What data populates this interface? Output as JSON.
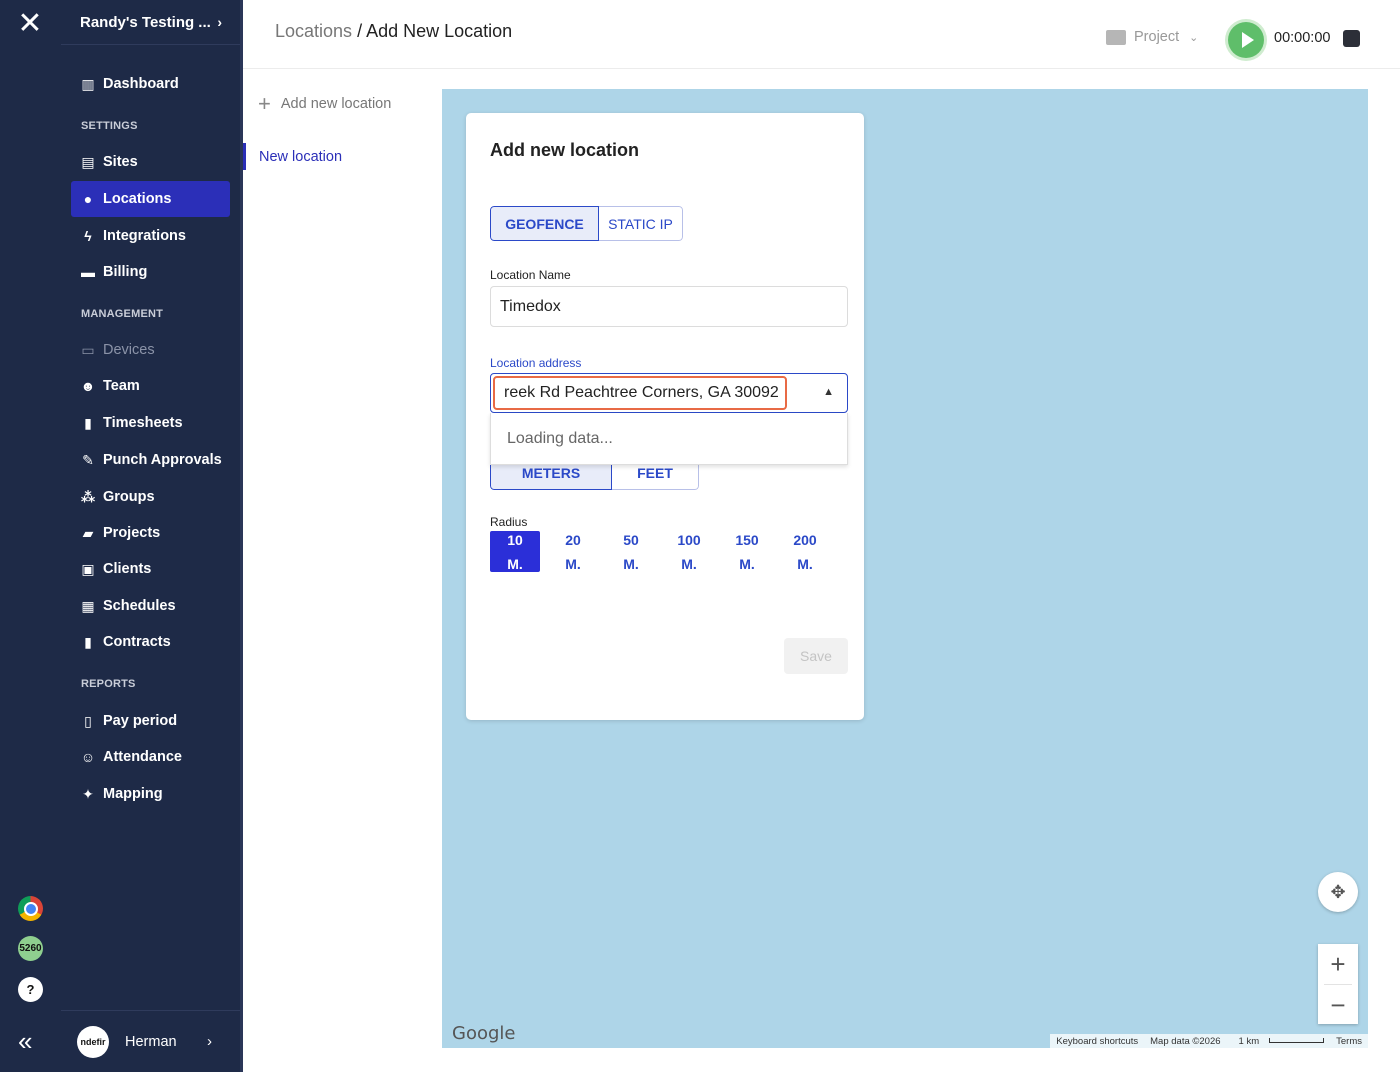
{
  "rail": {
    "logo": "✕",
    "badge_count": "5260",
    "help": "?",
    "collapse": "«"
  },
  "sidebar": {
    "org_name": "Randy's Testing ...",
    "sections": {
      "settings": "SETTINGS",
      "management": "MANAGEMENT",
      "reports": "REPORTS"
    },
    "items": [
      {
        "label": "Dashboard",
        "icon": "chart-icon"
      },
      {
        "label": "Sites",
        "icon": "store-icon"
      },
      {
        "label": "Locations",
        "icon": "pin-icon",
        "active": true
      },
      {
        "label": "Integrations",
        "icon": "bolt-icon"
      },
      {
        "label": "Billing",
        "icon": "card-icon"
      },
      {
        "label": "Devices",
        "icon": "device-icon",
        "disabled": true
      },
      {
        "label": "Team",
        "icon": "team-icon"
      },
      {
        "label": "Timesheets",
        "icon": "sheet-icon"
      },
      {
        "label": "Punch Approvals",
        "icon": "pen-icon"
      },
      {
        "label": "Groups",
        "icon": "groups-icon"
      },
      {
        "label": "Projects",
        "icon": "folder-icon"
      },
      {
        "label": "Clients",
        "icon": "contact-icon"
      },
      {
        "label": "Schedules",
        "icon": "calendar-icon"
      },
      {
        "label": "Contracts",
        "icon": "book-icon"
      },
      {
        "label": "Pay period",
        "icon": "clipboard-icon"
      },
      {
        "label": "Attendance",
        "icon": "user-icon"
      },
      {
        "label": "Mapping",
        "icon": "pushpin-icon"
      }
    ],
    "user": {
      "avatar_text": "ndefir",
      "name": "Herman"
    }
  },
  "header": {
    "breadcrumb_parent": "Locations",
    "breadcrumb_sep": " / ",
    "breadcrumb_current": "Add New Location",
    "project_label": "Project",
    "timer": "00:00:00"
  },
  "subnav": {
    "add_label": "Add new location",
    "active_label": "New location"
  },
  "form": {
    "title": "Add new location",
    "type_options": [
      "GEOFENCE",
      "STATIC IP"
    ],
    "type_selected": "GEOFENCE",
    "name_label": "Location Name",
    "name_value": "Timedox",
    "address_label": "Location address",
    "address_value": "reek Rd Peachtree Corners, GA 30092",
    "dropdown_text": "Loading data...",
    "unit_options": [
      "METERS",
      "FEET"
    ],
    "unit_selected": "METERS",
    "radius_label": "Radius",
    "radius_options": [
      {
        "value": "10",
        "unit": "M."
      },
      {
        "value": "20",
        "unit": "M."
      },
      {
        "value": "50",
        "unit": "M."
      },
      {
        "value": "100",
        "unit": "M."
      },
      {
        "value": "150",
        "unit": "M."
      },
      {
        "value": "200",
        "unit": "M."
      }
    ],
    "radius_selected": "10",
    "save_label": "Save"
  },
  "map": {
    "brand": "Google",
    "keyboard": "Keyboard shortcuts",
    "map_data": "Map data ©2026",
    "scale": "1 km",
    "terms": "Terms",
    "water_color": "#aed5e8"
  },
  "colors": {
    "sidebar_bg": "#1e2a47",
    "accent": "#2b2fb8",
    "focus_ring": "#e86a45"
  }
}
